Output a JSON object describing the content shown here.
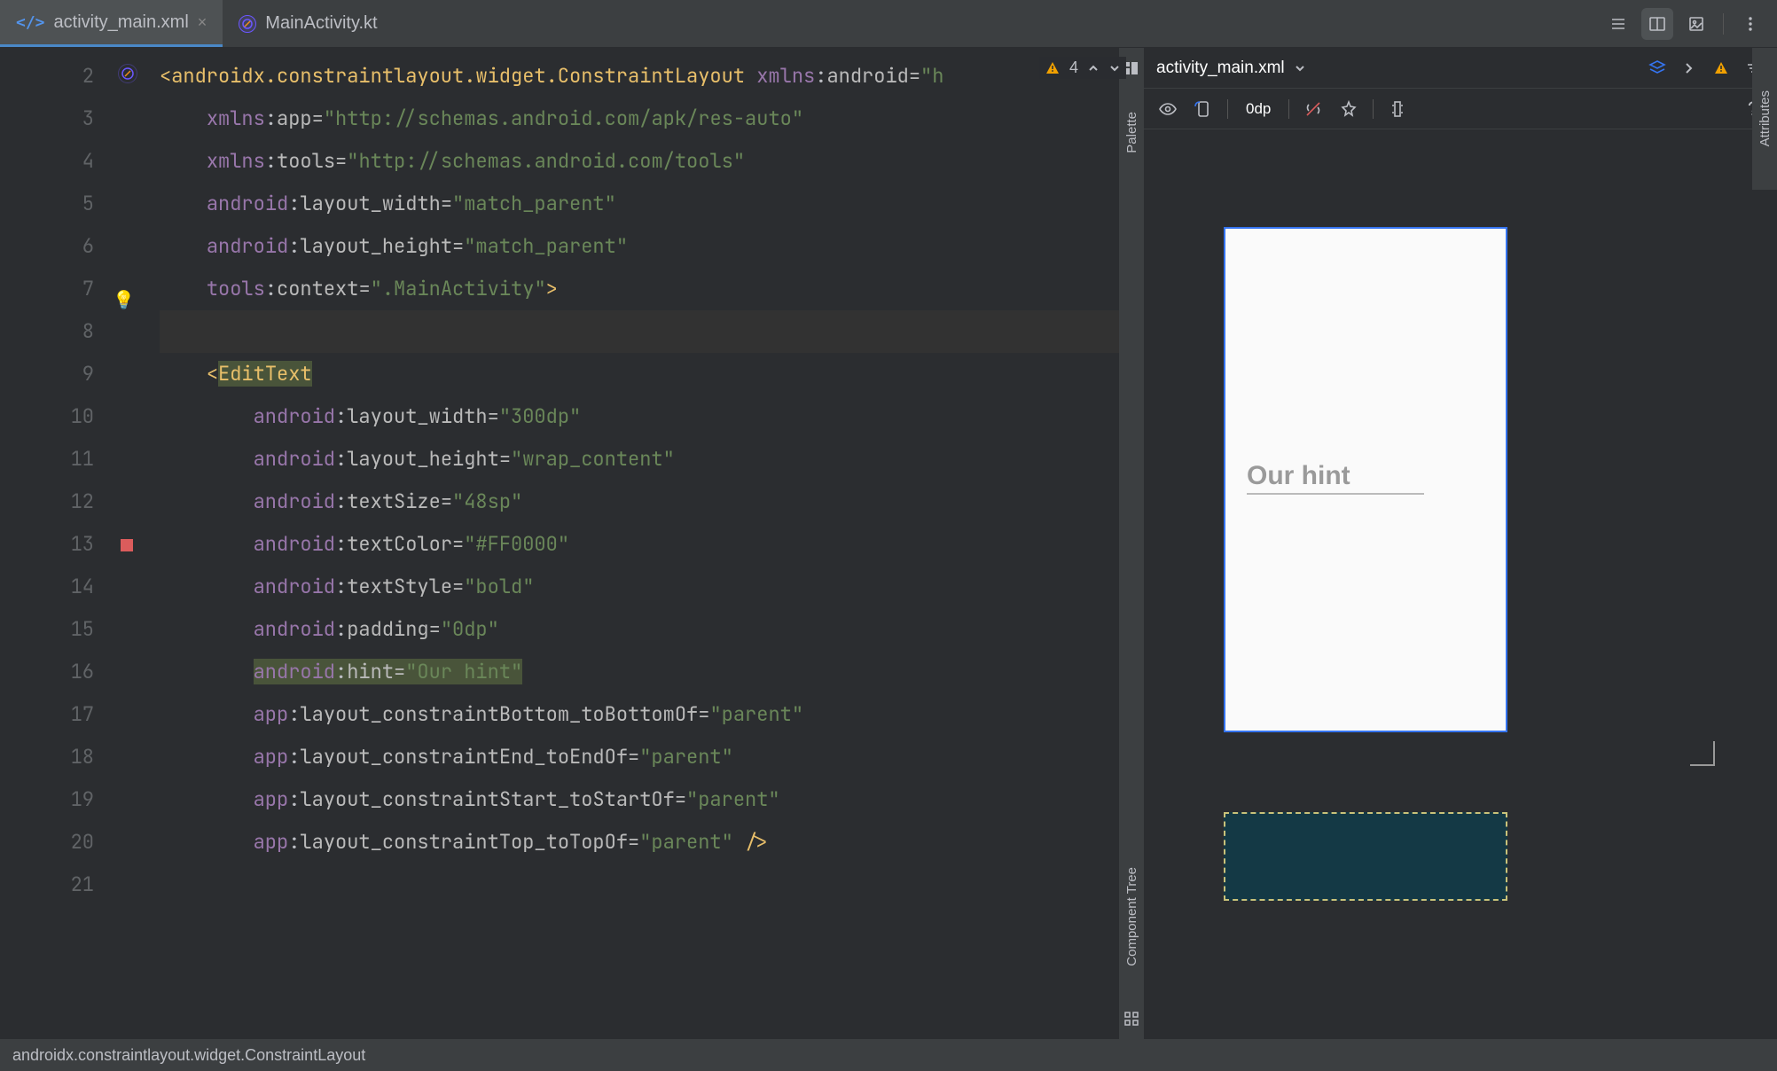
{
  "tabs": {
    "active": {
      "label": "activity_main.xml"
    },
    "inactive": {
      "label": "MainActivity.kt"
    }
  },
  "editor": {
    "warnings": "4",
    "lines": {
      "start": 2,
      "end": 21
    }
  },
  "code": {
    "root_tag": "androidx.constraintlayout.widget.ConstraintLayout",
    "xmlns_android_ns": "xmlns",
    "xmlns_android_key": "android",
    "xmlns_android_val_trunc": "\"h",
    "xmlns_app_val": "\"http://schemas.android.com/apk/res-auto\"",
    "xmlns_tools_val": "\"http://schemas.android.com/tools\"",
    "layout_width_val": "\"match_parent\"",
    "layout_height_val": "\"match_parent\"",
    "tools_context_val": "\".MainActivity\"",
    "edittext_tag": "EditText",
    "et_width_val": "\"300dp\"",
    "et_height_val": "\"wrap_content\"",
    "et_textsize_val": "\"48sp\"",
    "et_textcolor_val": "\"#FF0000\"",
    "et_textstyle_val": "\"bold\"",
    "et_padding_val": "\"0dp\"",
    "et_hint_val": "\"Our hint\"",
    "parent_val": "\"parent\"",
    "ns_android": "android",
    "ns_app": "app",
    "ns_tools": "tools",
    "ns_xmlns": "xmlns",
    "attr_app": "app",
    "attr_tools": "tools",
    "attr_layout_width": "layout_width",
    "attr_layout_height": "layout_height",
    "attr_context": "context",
    "attr_textSize": "textSize",
    "attr_textColor": "textColor",
    "attr_textStyle": "textStyle",
    "attr_padding": "padding",
    "attr_hint": "hint",
    "attr_cbottom": "layout_constraintBottom_toBottomOf",
    "attr_cend": "layout_constraintEnd_toEndOf",
    "attr_cstart": "layout_constraintStart_toStartOf",
    "attr_ctop": "layout_constraintTop_toTopOf"
  },
  "side": {
    "palette": "Palette",
    "component_tree": "Component Tree",
    "attributes": "Attributes"
  },
  "design": {
    "filename": "activity_main.xml",
    "zoom": "0dp",
    "hint_text": "Our hint"
  },
  "status": {
    "breadcrumb": "androidx.constraintlayout.widget.ConstraintLayout"
  }
}
